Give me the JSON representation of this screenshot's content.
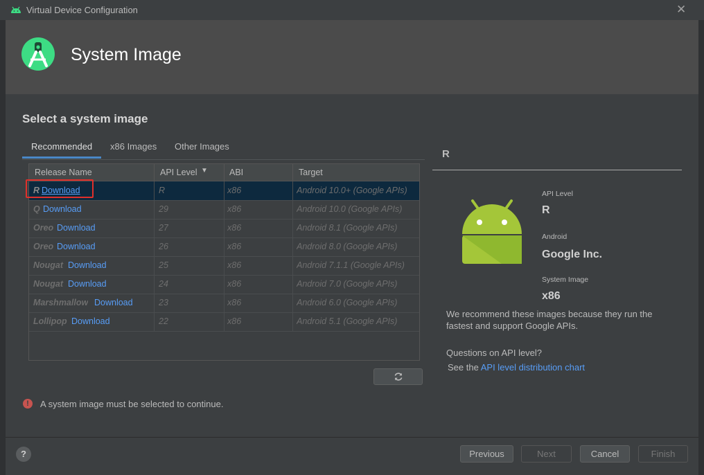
{
  "window": {
    "title": "Virtual Device Configuration",
    "close_glyph": "✕"
  },
  "header": {
    "title": "System Image"
  },
  "main": {
    "title": "Select a system image"
  },
  "tabs": [
    {
      "label": "Recommended",
      "active": true
    },
    {
      "label": "x86 Images",
      "active": false
    },
    {
      "label": "Other Images",
      "active": false
    }
  ],
  "table": {
    "columns": [
      "Release Name",
      "API Level",
      "ABI",
      "Target"
    ],
    "sort_glyph": "▼",
    "rows": [
      {
        "name": "R",
        "download": "Download",
        "api": "R",
        "abi": "x86",
        "target": "Android 10.0+ (Google APIs)"
      },
      {
        "name": "Q",
        "download": "Download",
        "api": "29",
        "abi": "x86",
        "target": "Android 10.0 (Google APIs)"
      },
      {
        "name": "Oreo",
        "download": "Download",
        "api": "27",
        "abi": "x86",
        "target": "Android 8.1 (Google APIs)"
      },
      {
        "name": "Oreo",
        "download": "Download",
        "api": "26",
        "abi": "x86",
        "target": "Android 8.0 (Google APIs)"
      },
      {
        "name": "Nougat",
        "download": "Download",
        "api": "25",
        "abi": "x86",
        "target": "Android 7.1.1 (Google APIs)"
      },
      {
        "name": "Nougat",
        "download": "Download",
        "api": "24",
        "abi": "x86",
        "target": "Android 7.0 (Google APIs)"
      },
      {
        "name": "Marshmallow",
        "download": "Download",
        "api": "23",
        "abi": "x86",
        "target": "Android 6.0 (Google APIs)"
      },
      {
        "name": "Lollipop",
        "download": "Download",
        "api": "22",
        "abi": "x86",
        "target": "Android 5.1 (Google APIs)"
      }
    ]
  },
  "error": {
    "icon": "!",
    "text": "A system image must be selected to continue."
  },
  "details": {
    "heading": "R",
    "api_level_label": "API Level",
    "api_level_value": "R",
    "android_label": "Android",
    "android_value": "Google Inc.",
    "system_image_label": "System Image",
    "system_image_value": "x86",
    "recommend_text": "We recommend these images because they run the fastest and support Google APIs.",
    "questions_text": "Questions on API level?",
    "see_prefix": "See the",
    "chart_link": "API level distribution chart"
  },
  "footer": {
    "help_label": "?",
    "previous": "Previous",
    "next": "Next",
    "cancel": "Cancel",
    "finish": "Finish"
  },
  "colors": {
    "accent": "#4a88c7",
    "link": "#589df6",
    "android_green": "#a4c639",
    "selected_row": "#0d293e",
    "error": "#c75450"
  }
}
